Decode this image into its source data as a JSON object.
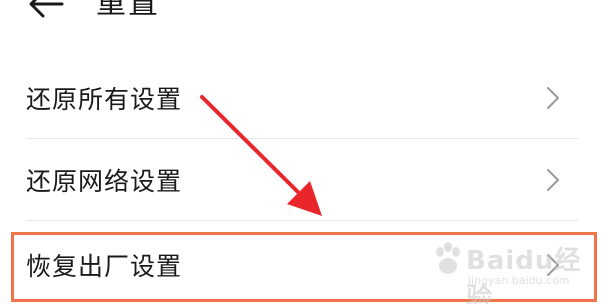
{
  "header": {
    "title": "重置",
    "back_icon": "arrow-left-icon"
  },
  "items": [
    {
      "label": "还原所有设置",
      "icon": "chevron-right-icon"
    },
    {
      "label": "还原网络设置",
      "icon": "chevron-right-icon"
    },
    {
      "label": "恢复出厂设置",
      "icon": "chevron-right-icon"
    }
  ],
  "annotation": {
    "arrow_color": "#e8262b",
    "highlight_color": "#f0744a"
  },
  "watermark": {
    "text": "Baidu经验",
    "sub": "jingyan.baidu.com"
  }
}
